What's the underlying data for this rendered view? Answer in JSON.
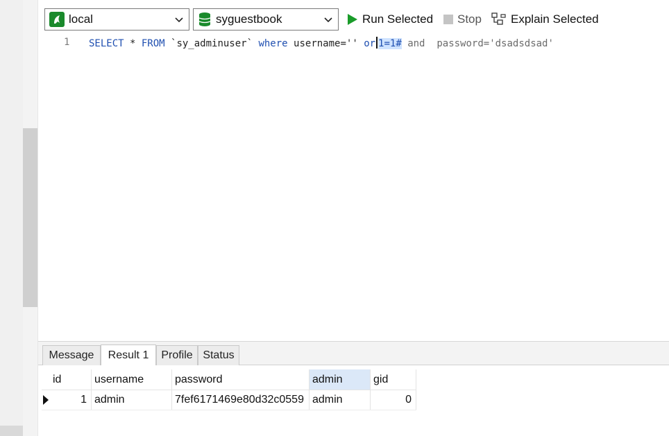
{
  "toolbar": {
    "connection": {
      "value": "local",
      "icon": "connection-icon"
    },
    "database": {
      "value": "syguestbook",
      "icon": "database-icon"
    },
    "run_label": "Run Selected",
    "stop_label": "Stop",
    "explain_label": "Explain Selected",
    "colors": {
      "run": "#1a9c2a",
      "stop": "#b5b5b5"
    }
  },
  "editor": {
    "line_number": "1",
    "code": {
      "kw_select": "SELECT",
      "star": " * ",
      "kw_from": "FROM",
      "table": " `sy_adminuser` ",
      "kw_where": "where",
      "cond1": " username='' ",
      "kw_or": "or",
      "selected": "1=1#",
      "rest": " and  password='dsadsdsad'"
    }
  },
  "results": {
    "tabs": [
      "Message",
      "Result 1",
      "Profile",
      "Status"
    ],
    "active_tab": "Result 1",
    "columns": [
      "id",
      "username",
      "password",
      "admin",
      "gid"
    ],
    "rows": [
      {
        "id": "1",
        "username": "admin",
        "password": "7fef6171469e80d32c0559",
        "admin": "admin",
        "gid": "0"
      }
    ]
  }
}
